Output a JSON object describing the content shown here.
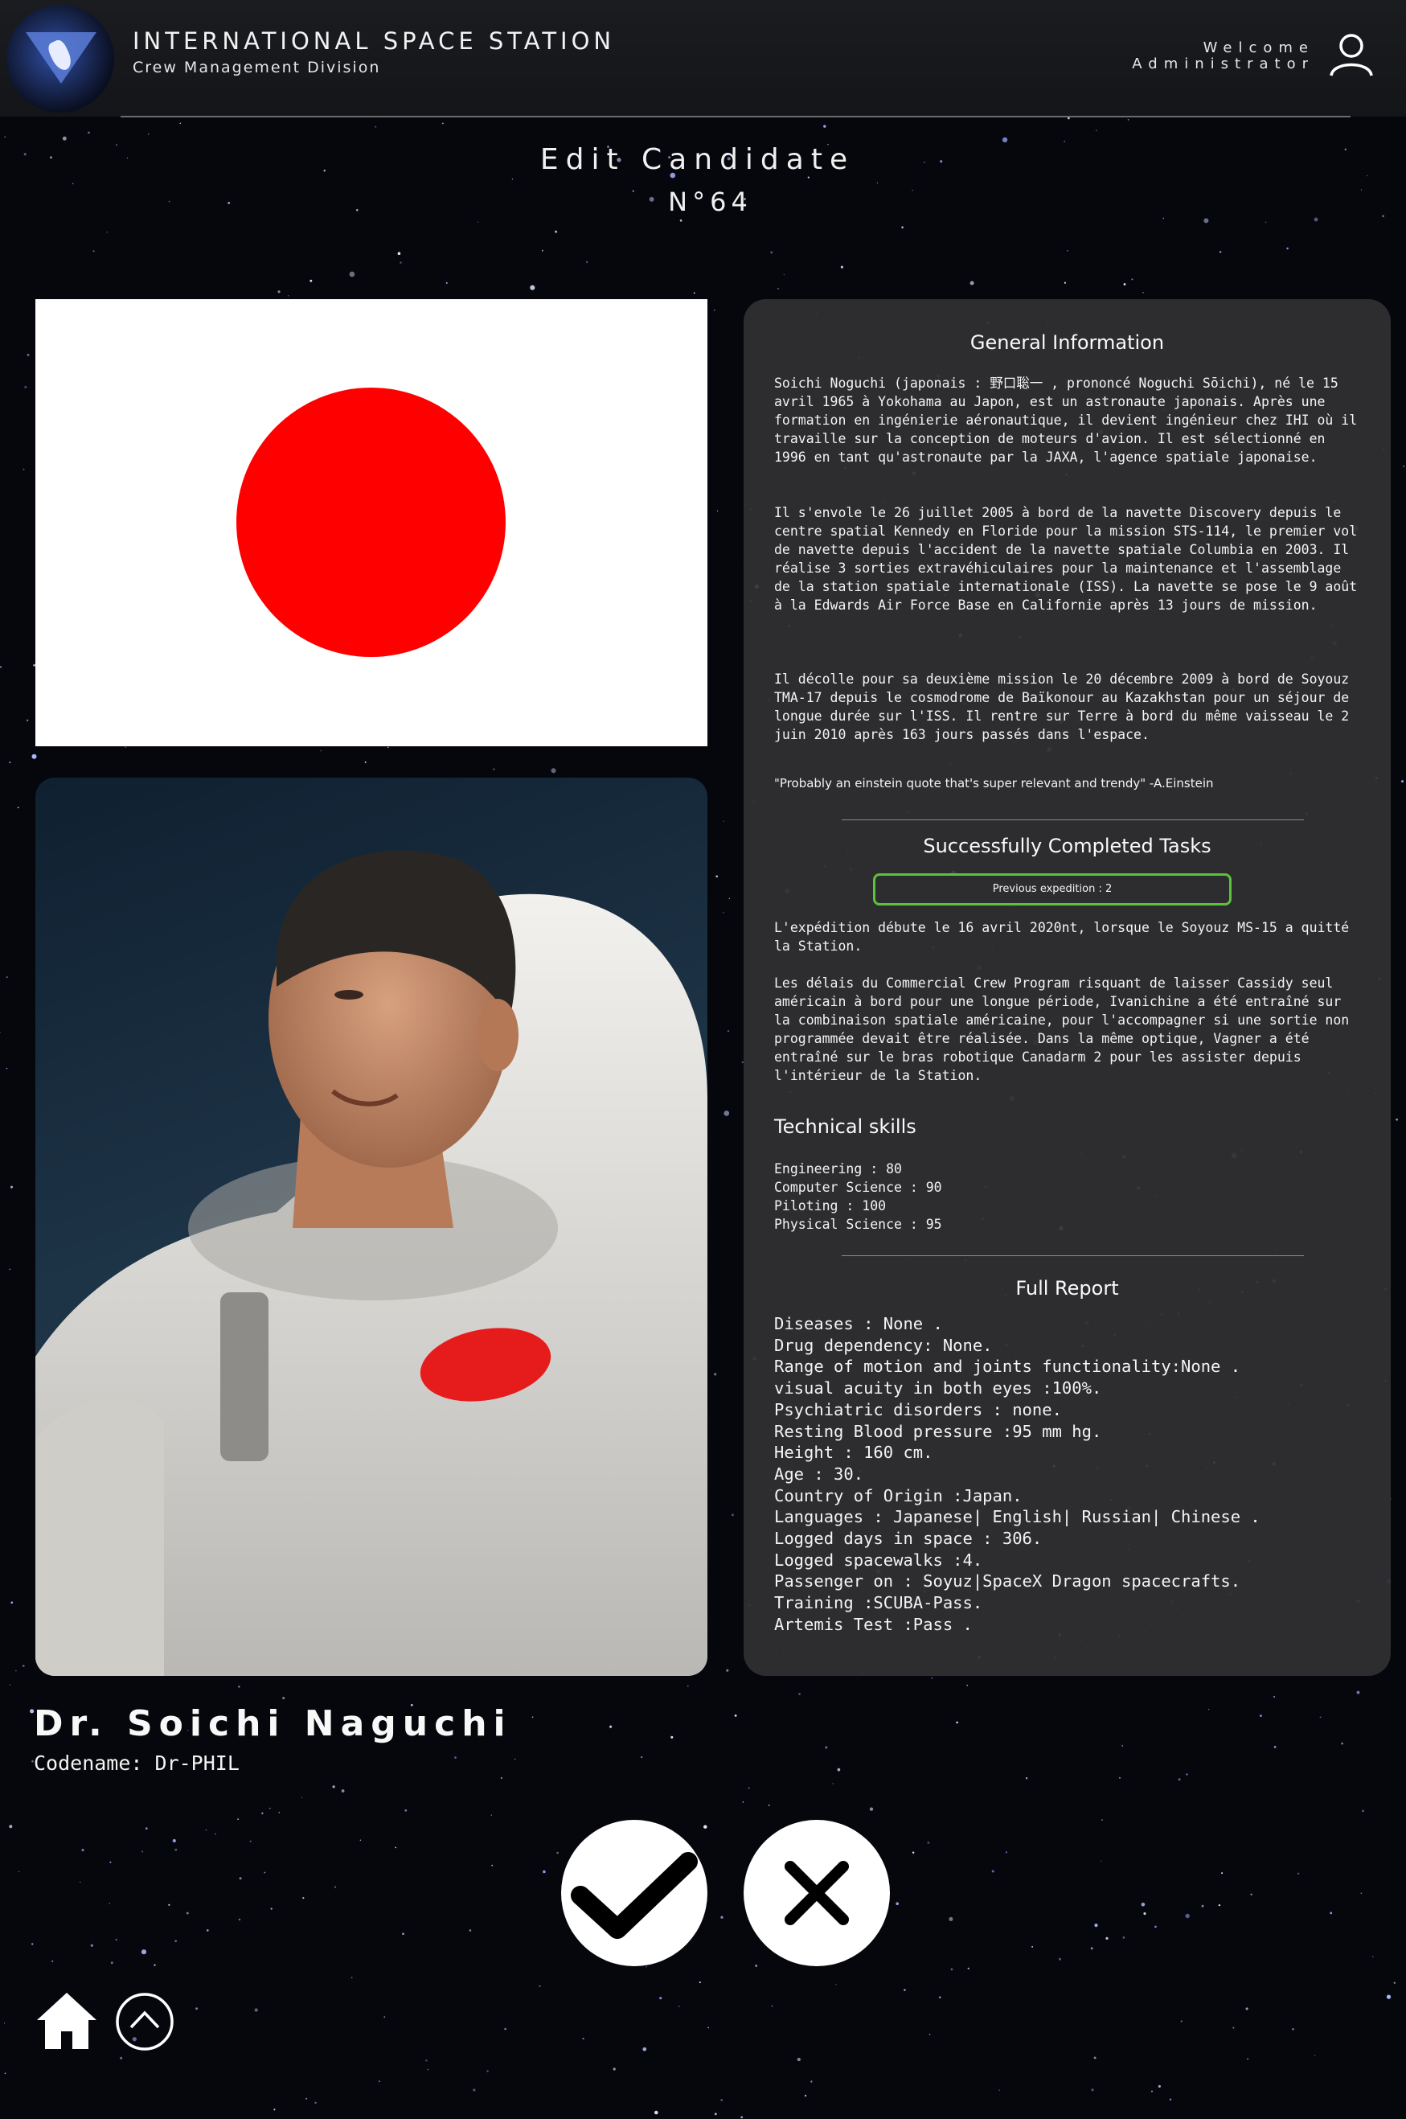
{
  "header": {
    "org_title": "INTERNATIONAL SPACE STATION",
    "org_subtitle": "Crew Management Division",
    "welcome_line1": "Welcome",
    "welcome_line2": "Administrator",
    "logo_icon": "iss-logo-icon",
    "user_icon": "user-icon"
  },
  "page": {
    "title": "Edit Candidate",
    "number": "N°64"
  },
  "candidate": {
    "name": "Dr. Soichi Naguchi",
    "codename": "Codename: Dr-PHIL",
    "flag": "japan-flag",
    "photo": "astronaut-portrait"
  },
  "general": {
    "heading": "General Information",
    "paragraphs": [
      "Soichi Noguchi (japonais : 野口聡一 , prononcé Noguchi Sōichi), né le 15 avril 1965 à Yokohama au Japon, est un astronaute japonais. Après une formation en ingénierie aéronautique, il devient ingénieur chez IHI où il travaille sur la conception de moteurs d'avion. Il est sélectionné en 1996 en tant qu'astronaute par la JAXA, l'agence spatiale japonaise.",
      "Il s'envole le 26 juillet 2005 à bord de la navette Discovery depuis le centre spatial Kennedy en Floride pour la mission STS-114, le premier vol de navette depuis l'accident de la navette spatiale Columbia en 2003. Il réalise 3 sorties extravéhiculaires pour la maintenance et l'assemblage de la station spatiale internationale (ISS). La navette se pose le 9 août à la Edwards Air Force Base en Californie après 13 jours de mission.",
      "Il décolle pour sa deuxième mission le 20 décembre 2009 à bord de Soyouz TMA-17 depuis le cosmodrome de Baïkonour au Kazakhstan pour un séjour de longue durée sur l'ISS. Il rentre sur Terre à bord du même vaisseau le 2 juin 2010 après 163 jours passés dans l'espace."
    ],
    "quote": "\"Probably an einstein quote that's super relevant and trendy\" -A.Einstein"
  },
  "tasks": {
    "heading": "Successfully Completed Tasks",
    "badge": "Previous expedition : 2",
    "paragraphs": [
      "L'expédition débute le 16 avril 2020nt, lorsque le Soyouz MS-15 a quitté la Station.",
      "Les délais du Commercial Crew Program risquant de laisser Cassidy seul américain à bord pour une longue période, Ivanichine a été entraîné sur la combinaison spatiale américaine, pour l'accompagner si une sortie non programmée devait être réalisée. Dans la même optique, Vagner a été entraîné sur le bras robotique Canadarm 2 pour les assister depuis l'intérieur de la Station."
    ]
  },
  "skills": {
    "heading": "Technical skills",
    "items": [
      "Engineering : 80",
      "Computer Science : 90",
      "Piloting : 100",
      "Physical Science : 95"
    ]
  },
  "report": {
    "heading": "Full Report",
    "lines": [
      "Diseases : None .",
      "Drug dependency: None.",
      "Range of motion and joints functionality:None .",
      "visual acuity in both eyes :100%.",
      "Psychiatric disorders : none.",
      "Resting Blood pressure :95 mm hg.",
      "Height : 160 cm.",
      "Age : 30.",
      "Country of Origin :Japan.",
      "Languages : Japanese| English| Russian| Chinese .",
      "Logged days in space : 306.",
      "Logged spacewalks :4.",
      "Passenger on : Soyuz|SpaceX Dragon spacecrafts.",
      "Training :SCUBA-Pass.",
      "Artemis Test :Pass ."
    ]
  },
  "actions": {
    "confirm_icon": "checkmark-icon",
    "cancel_icon": "close-icon",
    "home_icon": "home-icon",
    "up_icon": "chevron-up-icon"
  },
  "colors": {
    "background": "#05070c",
    "card": "#303034",
    "badge_border": "#5cc23b",
    "flag_red": "#ff0000"
  }
}
